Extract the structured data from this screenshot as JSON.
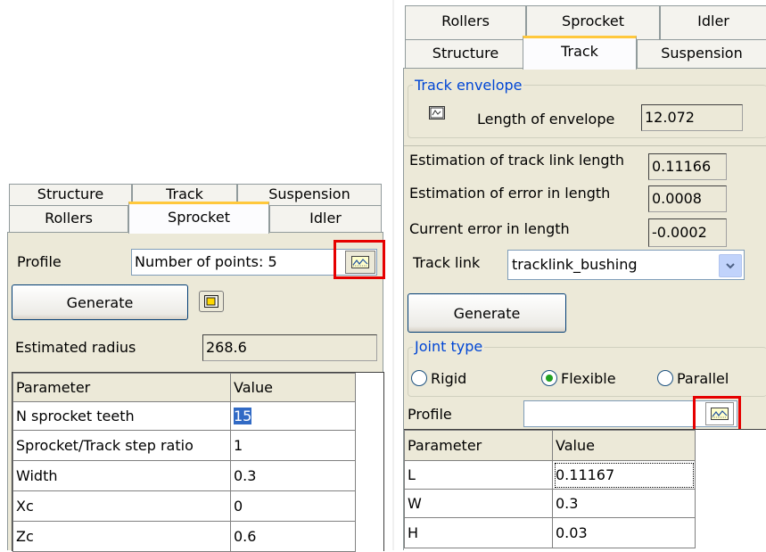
{
  "left_panel": {
    "tabs_row1": [
      "Structure",
      "Track",
      "Suspension"
    ],
    "tabs_row2": [
      "Rollers",
      "Sprocket",
      "Idler"
    ],
    "active_tab": "Sprocket",
    "profile_label": "Profile",
    "profile_value": "Number of points: 5",
    "generate_label": "Generate",
    "estimated_radius_label": "Estimated radius",
    "estimated_radius_value": "268.6",
    "table": {
      "headers": [
        "Parameter",
        "Value"
      ],
      "rows": [
        [
          "N sprocket teeth",
          "15"
        ],
        [
          "Sprocket/Track step ratio",
          "1"
        ],
        [
          "Width",
          "0.3"
        ],
        [
          "Xc",
          "0"
        ],
        [
          "Zc",
          "0.6"
        ]
      ]
    }
  },
  "right_panel": {
    "tabs_row1": [
      "Rollers",
      "Sprocket",
      "Idler"
    ],
    "tabs_row2": [
      "Structure",
      "Track",
      "Suspension"
    ],
    "active_tab": "Track",
    "track_envelope": {
      "title": "Track envelope",
      "length_label": "Length of envelope",
      "length_value": "12.072"
    },
    "estimation_link_label": "Estimation of track link length",
    "estimation_link_value": "0.11166",
    "estimation_error_label": "Estimation of error in length",
    "estimation_error_value": "0.0008",
    "current_error_label": "Current error in length",
    "current_error_value": "-0.0002",
    "track_link_label": "Track link",
    "track_link_value": "tracklink_bushing",
    "generate_label": "Generate",
    "joint_type": {
      "title": "Joint type",
      "options": [
        "Rigid",
        "Flexible",
        "Parallel"
      ],
      "selected": "Flexible"
    },
    "profile_label": "Profile",
    "profile_value": "",
    "table": {
      "headers": [
        "Parameter",
        "Value"
      ],
      "rows": [
        [
          "L",
          "0.11167"
        ],
        [
          "W",
          "0.3"
        ],
        [
          "H",
          "0.03"
        ]
      ]
    }
  },
  "colors": {
    "active_tab_accent": "#ffc83c",
    "highlight_box": "#e60000",
    "panel_background": "#ece9d8",
    "selection": "#316ac5"
  }
}
